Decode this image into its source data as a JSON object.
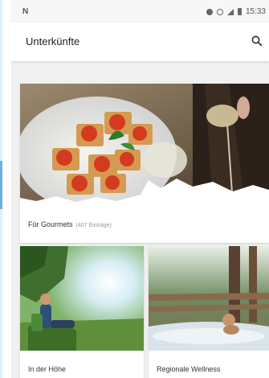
{
  "statusbar": {
    "left_icon": "N",
    "time": "15:33"
  },
  "appbar": {
    "title": "Unterkünfte",
    "search_icon": "search-icon"
  },
  "cards": [
    {
      "label": "Für Gourmets",
      "count": "(407 Einträge)"
    },
    {
      "label": "In der Höhe"
    },
    {
      "label": "Regionale Wellness"
    }
  ],
  "colors": {
    "background": "#f0f0f0",
    "appbar": "#ffffff",
    "accent_edge": "#6ab0e0"
  }
}
